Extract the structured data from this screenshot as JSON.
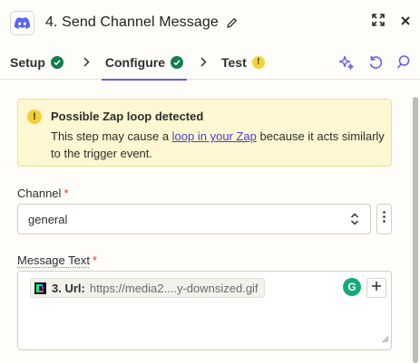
{
  "header": {
    "title": "4. Send Channel Message",
    "app_icon": "discord-icon"
  },
  "tabs": [
    {
      "label": "Setup",
      "status": "complete"
    },
    {
      "label": "Configure",
      "status": "complete"
    },
    {
      "label": "Test",
      "status": "warning"
    }
  ],
  "alert": {
    "title": "Possible Zap loop detected",
    "body_before": "This step may cause a ",
    "link_text": "loop in your Zap",
    "body_after": " because it acts similarly to the trigger event."
  },
  "channel": {
    "label": "Channel",
    "required_mark": "*",
    "value": "general"
  },
  "message": {
    "label": "Message Text",
    "required_mark": "*",
    "pill_key": "3. Url:",
    "pill_value": "https://media2....y-downsized.gif",
    "grammarly_glyph": "G"
  },
  "colors": {
    "accent": "#6a5de8",
    "success": "#117e4f",
    "warning": "#f3d23c",
    "alert_bg": "#fdf8d1",
    "required": "#d93a2b",
    "link": "#4a3dd6"
  }
}
